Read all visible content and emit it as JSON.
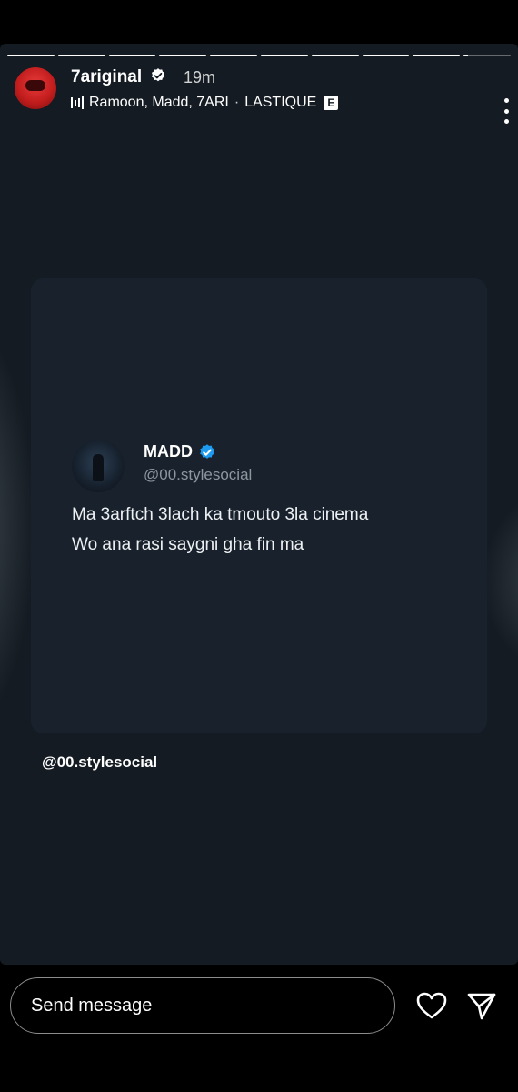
{
  "story": {
    "progress_segments": [
      1,
      1,
      1,
      1,
      1,
      1,
      1,
      1,
      1,
      0.1
    ],
    "user": {
      "username": "7ariginal",
      "time_ago": "19m",
      "avatar_icon": "red-masked-avatar-icon"
    },
    "music": {
      "icon": "music-bars-icon",
      "artists": "Ramoon, Madd, 7ARI",
      "separator": "·",
      "song": "LASTIQUE",
      "explicit_label": "E"
    },
    "menu_icon": "more-vertical-icon"
  },
  "tweet": {
    "display_name": "MADD",
    "handle": "@00.stylesocial",
    "verified_color": "#1d9bf0",
    "line1": "Ma 3arftch 3lach ka tmouto 3la cinema",
    "line2": "Wo ana rasi saygni gha fin ma"
  },
  "mention_sticker": "@00.stylesocial",
  "composer": {
    "placeholder": "Send message",
    "like_icon": "heart-icon",
    "send_icon": "send-icon"
  },
  "colors": {
    "story_bg": "#141b22",
    "card_bg": "#19222c",
    "handle_text": "#8d969f"
  }
}
